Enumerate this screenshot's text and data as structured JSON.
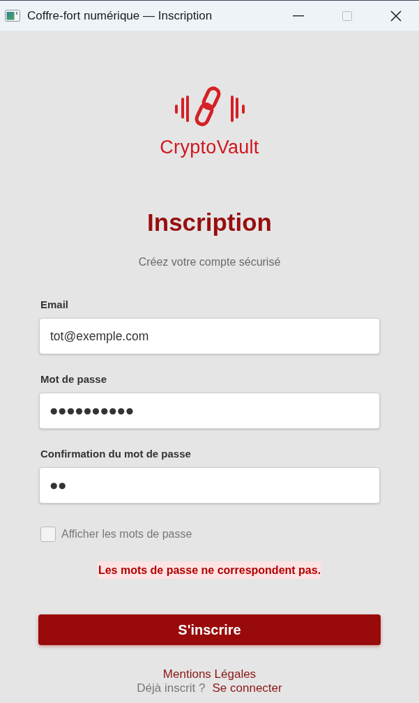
{
  "window": {
    "title": "Coffre-fort numérique — Inscription"
  },
  "brand": {
    "name": "CryptoVault"
  },
  "header": {
    "title": "Inscription",
    "subtitle": "Créez votre compte sécurisé"
  },
  "form": {
    "fields": [
      {
        "label": "Email",
        "kind": "text",
        "value": "tot@exemple.com"
      },
      {
        "label": "Mot de passe",
        "kind": "password",
        "value": "●●●●●●●●●●"
      },
      {
        "label": "Confirmation du mot de passe",
        "kind": "password",
        "value": "●●"
      }
    ],
    "show_passwords": {
      "label": "Afficher les mots de passe",
      "checked": false
    },
    "error": "Les mots de passe ne correspondent pas.",
    "submit_button": "S'inscrire"
  },
  "footer": {
    "legal_link": "Mentions Légales",
    "login_prompt": "Déjà inscrit ?",
    "login_link": "Se connecter"
  }
}
